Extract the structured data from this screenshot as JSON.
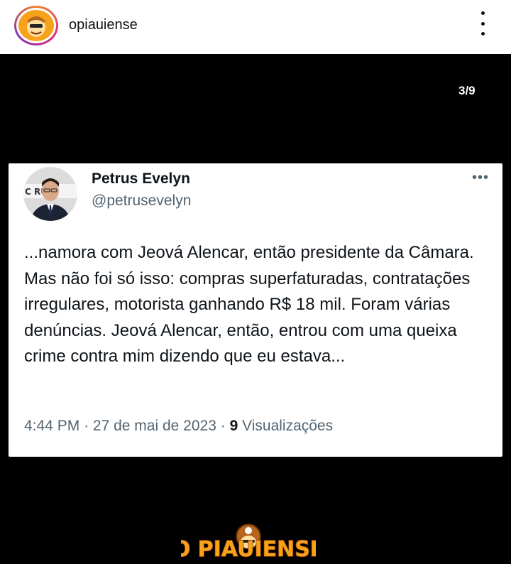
{
  "header": {
    "username": "opiauiense",
    "more_icon": "more-vertical-icon"
  },
  "post": {
    "page_counter": "3/9",
    "tweet": {
      "display_name": "Petrus Evelyn",
      "handle": "@petrusevelyn",
      "more_icon": "more-horizontal-icon",
      "avatar_sign_text": "C RU",
      "text": "...namora com Jeová Alencar, então presidente da Câmara. Mas não foi só isso: compras superfaturadas, contratações irregulares, motorista ganhando R$ 18 mil. Foram várias denúncias. Jeová Alencar, então, entrou com uma queixa crime contra mim dizendo que eu estava...",
      "time": "4:44 PM",
      "separator": "·",
      "date": "27 de mai de 2023",
      "views_count": "9",
      "views_label": "Visualizações"
    },
    "brand_logo_text": "O PIAUIENSE"
  },
  "colors": {
    "header_bg": "#ffffff",
    "post_bg": "#000000",
    "card_bg": "#ffffff",
    "text_primary": "#0f1419",
    "text_secondary": "#536471",
    "brand_orange": "#f7a21b"
  }
}
